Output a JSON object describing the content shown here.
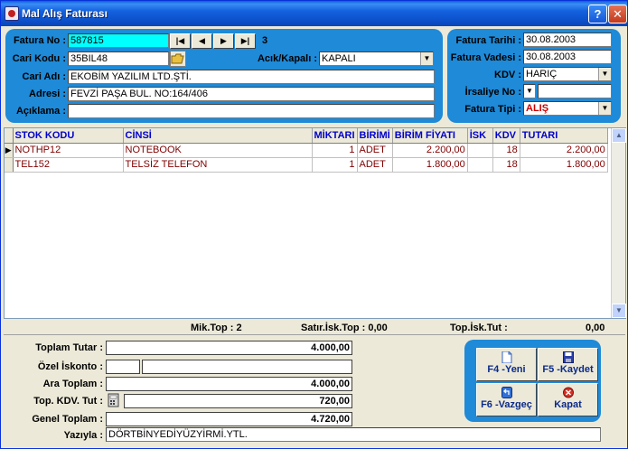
{
  "window": {
    "title": "Mal Alış Faturası"
  },
  "header": {
    "fatura_no_label": "Fatura No :",
    "fatura_no": "587815",
    "record_count": "3",
    "cari_kodu_label": "Cari Kodu :",
    "cari_kodu": "35BIL48",
    "acik_kapali_label": "Acık/Kapalı :",
    "acik_kapali": "KAPALI",
    "cari_adi_label": "Cari Adı :",
    "cari_adi": "EKOBİM YAZILIM LTD.ŞTİ.",
    "adresi_label": "Adresi :",
    "adresi": "FEVZİ PAŞA BUL. NO:164/406",
    "aciklama_label": "Açıklama :",
    "aciklama": "",
    "fatura_tarihi_label": "Fatura Tarihi :",
    "fatura_tarihi": "30.08.2003",
    "fatura_vadesi_label": "Fatura Vadesi :",
    "fatura_vadesi": "30.08.2003",
    "kdv_label": "KDV :",
    "kdv": "HARIÇ",
    "irsaliye_label": "İrsaliye No :",
    "irsaliye_no": "",
    "fatura_tipi_label": "Fatura Tipi :",
    "fatura_tipi": "ALIŞ"
  },
  "grid": {
    "columns": [
      "STOK KODU",
      "CİNSİ",
      "MİKTARI",
      "BİRİMİ",
      "BİRİM FİYATI",
      "İSK",
      "KDV",
      "TUTARI"
    ],
    "rows": [
      {
        "stok_kodu": "NOTHP12",
        "cinsi": "NOTEBOOK",
        "miktari": "1",
        "birimi": "ADET",
        "birim_fiyati": "2.200,00",
        "isk": "",
        "kdv": "18",
        "tutari": "2.200,00"
      },
      {
        "stok_kodu": "TEL152",
        "cinsi": "TELSİZ TELEFON",
        "miktari": "1",
        "birimi": "ADET",
        "birim_fiyati": "1.800,00",
        "isk": "",
        "kdv": "18",
        "tutari": "1.800,00"
      }
    ]
  },
  "summary": {
    "mik_top": "Mik.Top : 2",
    "satir_isk_top": "Satır.İsk.Top : 0,00",
    "top_isk_tut_label": "Top.İsk.Tut :",
    "top_isk_tut": "0,00"
  },
  "totals": {
    "toplam_tutar_label": "Toplam Tutar :",
    "toplam_tutar": "4.000,00",
    "ozel_iskonto_label": "Özel İskonto :",
    "ozel_iskonto_a": "",
    "ozel_iskonto_b": "",
    "ara_toplam_label": "Ara Toplam :",
    "ara_toplam": "4.000,00",
    "top_kdv_label": "Top. KDV. Tut :",
    "top_kdv": "720,00",
    "genel_toplam_label": "Genel Toplam :",
    "genel_toplam": "4.720,00",
    "yaziyla_label": "Yazıyla :",
    "yaziyla": "DÖRTBİNYEDİYÜZYİRMİ.YTL."
  },
  "buttons": {
    "yeni": "F4 -Yeni",
    "kaydet": "F5 -Kaydet",
    "vazgec": "F6 -Vazgeç",
    "kapat": "Kapat"
  },
  "colors": {
    "panel": "#1e8ad8",
    "title_bar": "#0b4fc9",
    "grid_header_text": "#0000cc",
    "grid_cell_text": "#800000",
    "highlight_field": "#00ffff"
  }
}
